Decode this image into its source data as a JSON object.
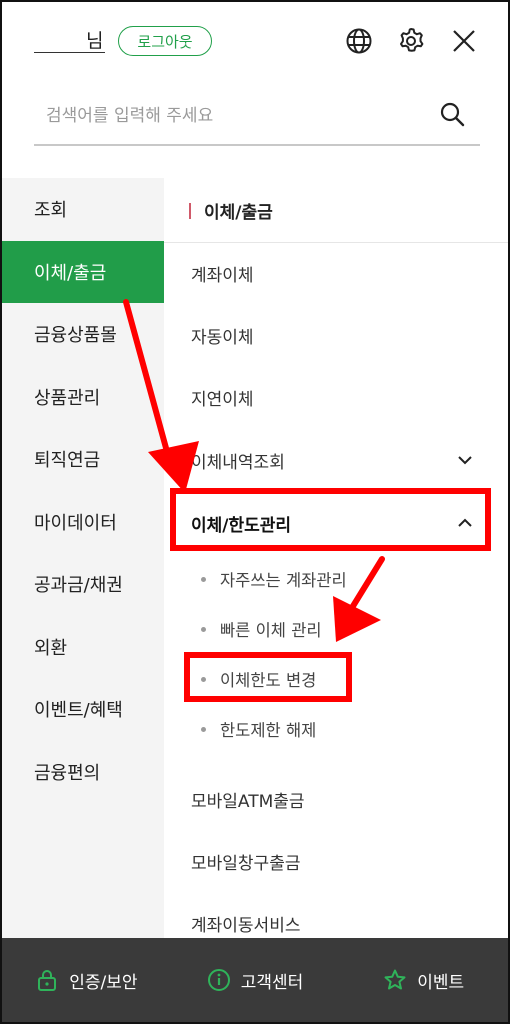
{
  "header": {
    "user_suffix": "님",
    "logout_label": "로그아웃"
  },
  "search": {
    "placeholder": "검색어를 입력해 주세요"
  },
  "left_nav": {
    "items": [
      {
        "label": "조회"
      },
      {
        "label": "이체/출금"
      },
      {
        "label": "금융상품몰"
      },
      {
        "label": "상품관리"
      },
      {
        "label": "퇴직연금"
      },
      {
        "label": "마이데이터"
      },
      {
        "label": "공과금/채권"
      },
      {
        "label": "외환"
      },
      {
        "label": "이벤트/혜택"
      },
      {
        "label": "금융편의"
      }
    ],
    "active_index": 1
  },
  "panel": {
    "title": "이체/출금",
    "items": [
      {
        "label": "계좌이체"
      },
      {
        "label": "자동이체"
      },
      {
        "label": "지연이체"
      },
      {
        "label": "이체내역조회"
      },
      {
        "label": "이체/한도관리"
      }
    ],
    "subitems": [
      {
        "label": "자주쓰는 계좌관리"
      },
      {
        "label": "빠른 이체 관리"
      },
      {
        "label": "이체한도 변경"
      },
      {
        "label": "한도제한 해제"
      }
    ],
    "more_items": [
      {
        "label": "모바일ATM출금"
      },
      {
        "label": "모바일창구출금"
      },
      {
        "label": "계좌이동서비스"
      }
    ]
  },
  "bottom_bar": {
    "items": [
      {
        "label": "인증/보안",
        "icon": "lock-icon"
      },
      {
        "label": "고객센터",
        "icon": "info-icon"
      },
      {
        "label": "이벤트",
        "icon": "star-icon"
      }
    ]
  },
  "colors": {
    "accent_green": "#219d49",
    "annotation_red": "#ff0000",
    "bottom_bar": "#3a3a3a"
  }
}
